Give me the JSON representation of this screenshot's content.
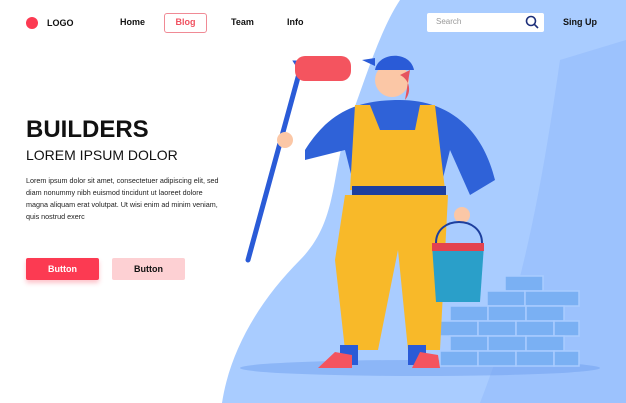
{
  "nav": {
    "logo": "LOGO",
    "links": [
      "Home",
      "Blog",
      "Team",
      "Info"
    ],
    "active": "Blog",
    "search_placeholder": "Search",
    "signup": "Sing Up"
  },
  "hero": {
    "title": "BUILDERS",
    "subtitle": "LOREM IPSUM DOLOR",
    "body": "Lorem ipsum dolor sit amet, consectetuer adipiscing elit, sed diam nonummy nibh euismod tincidunt ut laoreet dolore magna aliquam erat volutpat. Ut wisi enim ad minim veniam, quis nostrud exerc",
    "button_primary": "Button",
    "button_secondary": "Button"
  },
  "colors": {
    "accent": "#fc3a52",
    "blue": "#a9ccff"
  }
}
